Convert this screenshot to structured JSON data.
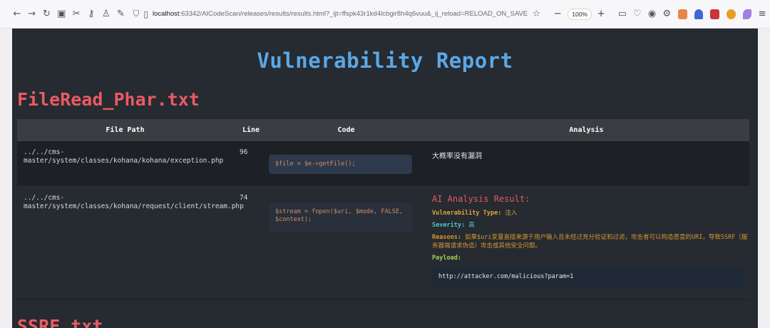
{
  "browser": {
    "url_host": "localhost",
    "url_rest": ":63342/AICodeScan/releases/results/results.html?_ijt=ffspk43r1kd4lcbgir8h4q6vuu&_ij_reload=RELOAD_ON_SAVE",
    "zoom": "100%",
    "zoom_minus": "−",
    "zoom_plus": "+"
  },
  "page": {
    "title": "Vulnerability Report",
    "sections": [
      {
        "title": "FileRead_Phar.txt",
        "headers": [
          "File Path",
          "Line",
          "Code",
          "Analysis"
        ],
        "rows": [
          {
            "path": "../../cms-master/system/classes/kohana/kohana/exception.php",
            "line": "96",
            "code": "$file     = $e->getFile();",
            "analysis": "大概率没有漏洞"
          },
          {
            "path": "../../cms-master/system/classes/kohana/request/client/stream.php",
            "line": "74",
            "code": "$stream = fopen($uri, $mode, FALSE, $context);",
            "ai": {
              "title": "AI Analysis Result:",
              "type_label": "Vulnerability Type:",
              "type_value": "注入",
              "severity_label": "Severity:",
              "severity_value": "高",
              "reasons_label": "Reasons:",
              "reasons_value": "如果$uri变量直接来源于用户输入且未经过充分验证和过滤，攻击者可以构造恶意的URI，导致SSRF（服务器端请求伪造）攻击或其他安全问题。",
              "payload_label": "Payload:",
              "payload_value": "http://attacker.com/malicious?param=1"
            }
          }
        ]
      },
      {
        "title": "SSRF.txt"
      }
    ]
  },
  "colors": {
    "page_bg": "#262a31",
    "title": "#5aa8e6",
    "section": "#ea5a63"
  }
}
